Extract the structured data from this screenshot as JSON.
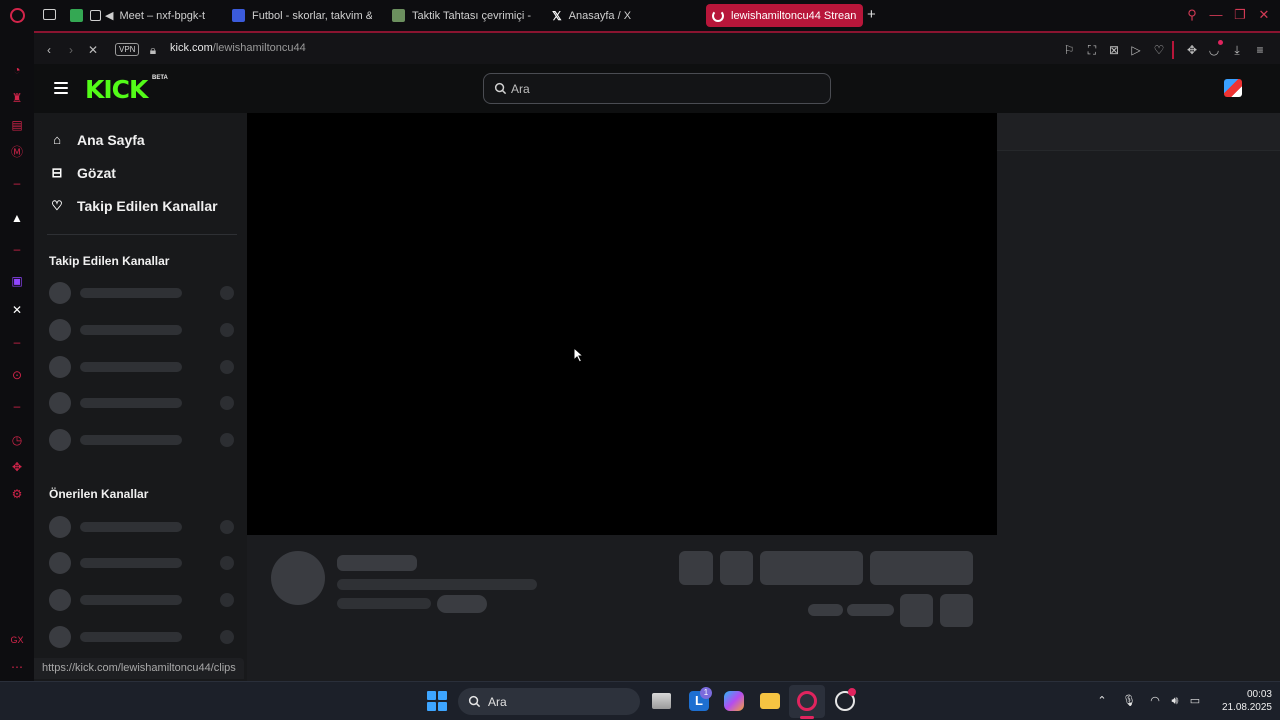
{
  "tabs": [
    {
      "label": "Meet – nxf-bpgk-t",
      "color": "#34a853"
    },
    {
      "label": "Futbol - skorlar, takvim &",
      "color": "#3b5bdb"
    },
    {
      "label": "Taktik Tahtası çevrimiçi -",
      "color": "#6b8f5e"
    },
    {
      "label": "Anasayfa / X",
      "color": "#ffffff"
    },
    {
      "label": "lewishamiltoncu44 Strean",
      "color": "#b8163a"
    }
  ],
  "address": {
    "vpn": "VPN",
    "url_host": "kick.com",
    "url_path": "/lewishamiltoncu44"
  },
  "kick": {
    "logo": "KICK",
    "beta": "BETA",
    "search_placeholder": "Ara",
    "nav": [
      {
        "label": "Ana Sayfa",
        "icon": "home-icon"
      },
      {
        "label": "Gözat",
        "icon": "browse-icon"
      },
      {
        "label": "Takip Edilen Kanallar",
        "icon": "heart-icon"
      }
    ],
    "followed_heading": "Takip Edilen Kanallar",
    "recommended_heading": "Önerilen Kanallar",
    "brand_color": "#53fc18"
  },
  "status_url": "https://kick.com/lewishamiltoncu44/clips",
  "taskbar": {
    "search_placeholder": "Ara",
    "time": "00:03",
    "date": "21.08.2025",
    "badge_count": "1"
  }
}
